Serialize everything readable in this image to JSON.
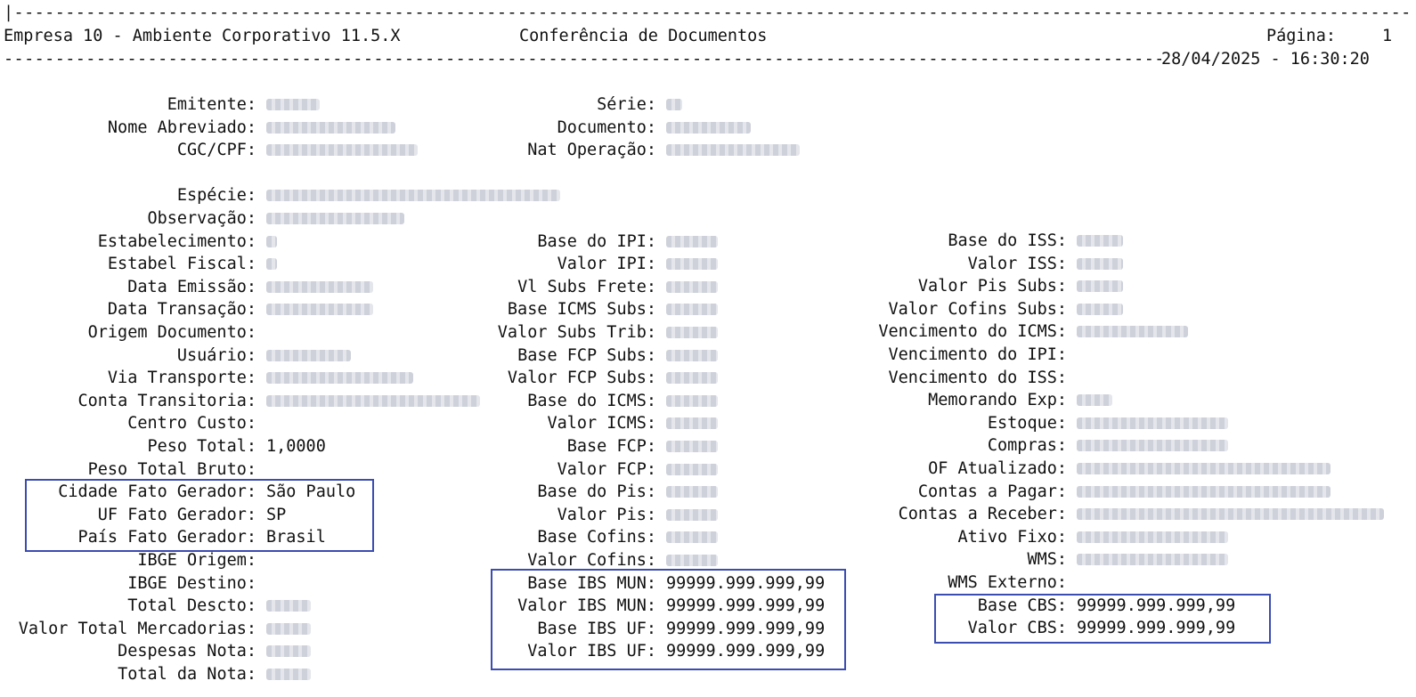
{
  "header": {
    "company": "Empresa 10 - Ambiente Corporativo 11.5.X",
    "report_title": "Conferência de Documentos",
    "page_label": "Página:",
    "page_number": "1",
    "datetime": "28/04/2025 - 16:30:20"
  },
  "col1": [
    {
      "label": "Emitente:",
      "value": ""
    },
    {
      "label": "Nome Abreviado:",
      "value": ""
    },
    {
      "label": "CGC/CPF:",
      "value": ""
    },
    {
      "label": "",
      "value": ""
    },
    {
      "label": "Espécie:",
      "value": ""
    },
    {
      "label": "Observação:",
      "value": ""
    },
    {
      "label": "Estabelecimento:",
      "value": ""
    },
    {
      "label": "Estabel Fiscal:",
      "value": ""
    },
    {
      "label": "Data Emissão:",
      "value": ""
    },
    {
      "label": "Data Transação:",
      "value": ""
    },
    {
      "label": "Origem Documento:",
      "value": ""
    },
    {
      "label": "Usuário:",
      "value": ""
    },
    {
      "label": "Via Transporte:",
      "value": ""
    },
    {
      "label": "Conta Transitoria:",
      "value": ""
    },
    {
      "label": "Centro Custo:",
      "value": ""
    },
    {
      "label": "Peso Total:",
      "value": "1,0000"
    },
    {
      "label": "Peso Total Bruto:",
      "value": ""
    },
    {
      "label": "Cidade Fato Gerador:",
      "value": "São Paulo"
    },
    {
      "label": "UF Fato Gerador:",
      "value": "SP"
    },
    {
      "label": "País Fato Gerador:",
      "value": "Brasil"
    },
    {
      "label": "IBGE Origem:",
      "value": ""
    },
    {
      "label": "IBGE Destino:",
      "value": ""
    },
    {
      "label": "Total Descto:",
      "value": ""
    },
    {
      "label": "Valor Total Mercadorias:",
      "value": ""
    },
    {
      "label": "Despesas Nota:",
      "value": ""
    },
    {
      "label": "Total da Nota:",
      "value": ""
    }
  ],
  "col2": [
    {
      "label": "Série:",
      "value": ""
    },
    {
      "label": "Documento:",
      "value": ""
    },
    {
      "label": "Nat Operação:",
      "value": ""
    },
    {
      "label": "",
      "value": ""
    },
    {
      "label": "",
      "value": ""
    },
    {
      "label": "",
      "value": ""
    },
    {
      "label": "Base do IPI:",
      "value": ""
    },
    {
      "label": "Valor IPI:",
      "value": ""
    },
    {
      "label": "Vl Subs Frete:",
      "value": ""
    },
    {
      "label": "Base ICMS Subs:",
      "value": ""
    },
    {
      "label": "Valor Subs Trib:",
      "value": ""
    },
    {
      "label": "Base FCP Subs:",
      "value": ""
    },
    {
      "label": "Valor FCP Subs:",
      "value": ""
    },
    {
      "label": "Base do ICMS:",
      "value": ""
    },
    {
      "label": "Valor ICMS:",
      "value": ""
    },
    {
      "label": "Base FCP:",
      "value": ""
    },
    {
      "label": "Valor FCP:",
      "value": ""
    },
    {
      "label": "Base do Pis:",
      "value": ""
    },
    {
      "label": "Valor Pis:",
      "value": ""
    },
    {
      "label": "Base Cofins:",
      "value": ""
    },
    {
      "label": "Valor Cofins:",
      "value": ""
    },
    {
      "label": "Base IBS MUN:",
      "value": "99999.999.999,99"
    },
    {
      "label": "Valor IBS MUN:",
      "value": "99999.999.999,99"
    },
    {
      "label": "Base IBS UF:",
      "value": "99999.999.999,99"
    },
    {
      "label": "Valor IBS UF:",
      "value": "99999.999.999,99"
    }
  ],
  "col3": [
    {
      "label": "Base do ISS:",
      "value": ""
    },
    {
      "label": "Valor ISS:",
      "value": ""
    },
    {
      "label": "Valor Pis Subs:",
      "value": ""
    },
    {
      "label": "Valor Cofins Subs:",
      "value": ""
    },
    {
      "label": "Vencimento do ICMS:",
      "value": ""
    },
    {
      "label": "Vencimento do IPI:",
      "value": ""
    },
    {
      "label": "Vencimento do ISS:",
      "value": ""
    },
    {
      "label": "Memorando Exp:",
      "value": ""
    },
    {
      "label": "Estoque:",
      "value": ""
    },
    {
      "label": "Compras:",
      "value": ""
    },
    {
      "label": "OF Atualizado:",
      "value": ""
    },
    {
      "label": "Contas a Pagar:",
      "value": ""
    },
    {
      "label": "Contas a Receber:",
      "value": ""
    },
    {
      "label": "Ativo Fixo:",
      "value": ""
    },
    {
      "label": "WMS:",
      "value": ""
    },
    {
      "label": "WMS Externo:",
      "value": ""
    },
    {
      "label": "Base CBS:",
      "value": "99999.999.999,99"
    },
    {
      "label": "Valor CBS:",
      "value": "99999.999.999,99"
    }
  ],
  "colors": {
    "text": "#111111",
    "highlight_border": "#3b4db0",
    "redaction": "#c9ccd6"
  }
}
